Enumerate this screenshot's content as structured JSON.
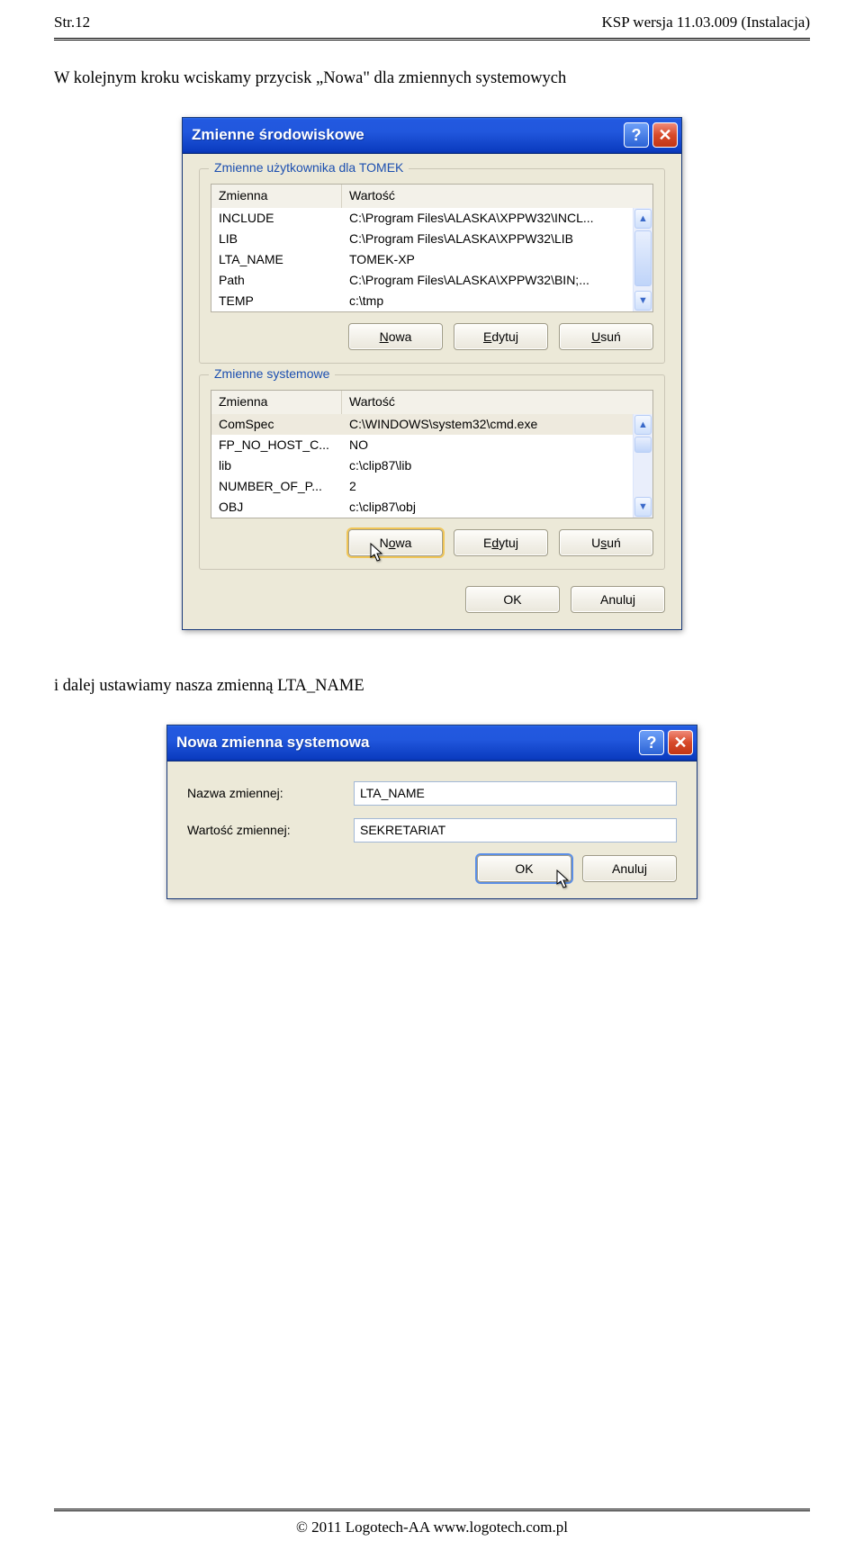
{
  "header": {
    "left": "Str.12",
    "right": "KSP wersja 11.03.009 (Instalacja)"
  },
  "text1": "W kolejnym kroku wciskamy przycisk „Nowa\" dla zmiennych systemowych",
  "text2": "i dalej ustawiamy nasza zmienną LTA_NAME",
  "footer": "© 2011 Logotech-AA www.logotech.com.pl",
  "dialog1": {
    "title": "Zmienne środowiskowe",
    "group1": {
      "legend": "Zmienne użytkownika dla TOMEK",
      "cols": {
        "var": "Zmienna",
        "val": "Wartość"
      },
      "rows": [
        {
          "var": "INCLUDE",
          "val": "C:\\Program Files\\ALASKA\\XPPW32\\INCL..."
        },
        {
          "var": "LIB",
          "val": "C:\\Program Files\\ALASKA\\XPPW32\\LIB"
        },
        {
          "var": "LTA_NAME",
          "val": "TOMEK-XP"
        },
        {
          "var": "Path",
          "val": "C:\\Program Files\\ALASKA\\XPPW32\\BIN;..."
        },
        {
          "var": "TEMP",
          "val": "c:\\tmp"
        }
      ],
      "buttons": {
        "new": "Nowa",
        "edit": "Edytuj",
        "delete": "Usuń"
      }
    },
    "group2": {
      "legend": "Zmienne systemowe",
      "cols": {
        "var": "Zmienna",
        "val": "Wartość"
      },
      "rows": [
        {
          "var": "ComSpec",
          "val": "C:\\WINDOWS\\system32\\cmd.exe",
          "sel": true
        },
        {
          "var": "FP_NO_HOST_C...",
          "val": "NO"
        },
        {
          "var": "lib",
          "val": "c:\\clip87\\lib"
        },
        {
          "var": "NUMBER_OF_P...",
          "val": "2"
        },
        {
          "var": "OBJ",
          "val": "c:\\clip87\\obj"
        }
      ],
      "buttons": {
        "new": "Nowa",
        "edit": "Edytuj",
        "delete": "Usuń"
      }
    },
    "footerButtons": {
      "ok": "OK",
      "cancel": "Anuluj"
    }
  },
  "dialog2": {
    "title": "Nowa zmienna systemowa",
    "labels": {
      "name": "Nazwa zmiennej:",
      "value": "Wartość zmiennej:"
    },
    "values": {
      "name": "LTA_NAME",
      "value": "SEKRETARIAT"
    },
    "buttons": {
      "ok": "OK",
      "cancel": "Anuluj"
    }
  }
}
